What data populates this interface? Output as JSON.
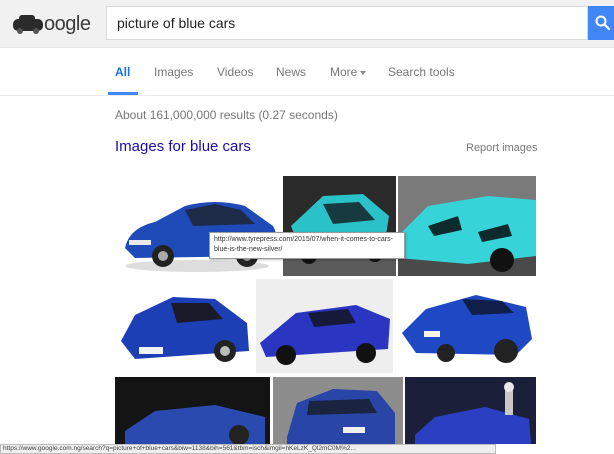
{
  "header": {
    "logo_text": "oogle",
    "search_value": "picture of blue cars",
    "search_icon": "search-icon"
  },
  "tabs": [
    {
      "label": "All",
      "active": true
    },
    {
      "label": "Images",
      "active": false
    },
    {
      "label": "Videos",
      "active": false
    },
    {
      "label": "News",
      "active": false
    },
    {
      "label": "More",
      "active": false
    },
    {
      "label": "Search tools",
      "active": false
    }
  ],
  "results": {
    "stats": "About 161,000,000 results (0.27 seconds)",
    "images_heading": "Images for blue cars",
    "report_link": "Report images"
  },
  "tooltip": {
    "url": "http://www.tyrepress.com/2015/07/when-it-comes-to-cars-blue-is-the-new-silver/"
  },
  "status_bar": {
    "url": "https://www.google.com.ng/search?q=picture+of+blue+cars&biw=1138&bih=561&tbm=isch&imgil=hKeLzK_Ql2mC0M%2..."
  },
  "colors": {
    "accent_blue": "#4285f4",
    "link_blue": "#1a0dab",
    "header_bg": "#f1f1f1"
  }
}
